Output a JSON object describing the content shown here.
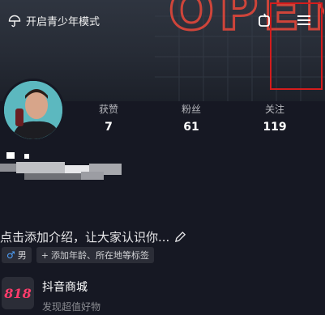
{
  "header": {
    "teen_mode_label": "开启青少年模式",
    "neon_text": "OPEN"
  },
  "profile": {
    "stats": [
      {
        "label": "获赞",
        "value": "7"
      },
      {
        "label": "粉丝",
        "value": "61"
      },
      {
        "label": "关注",
        "value": "119"
      }
    ],
    "intro_placeholder": "点击添加介绍，让大家认识你...",
    "tags": {
      "gender": "男",
      "add_tags": "添加年龄、所在地等标签"
    }
  },
  "shop": {
    "logo_text": "818",
    "title": "抖音商城",
    "subtitle": "发现超值好物"
  },
  "colors": {
    "background": "#161823",
    "neon": "#e0473a",
    "highlight": "#d41c1c",
    "shop_logo": "#ff3c6b",
    "gender_icon": "#4fa3ff"
  }
}
